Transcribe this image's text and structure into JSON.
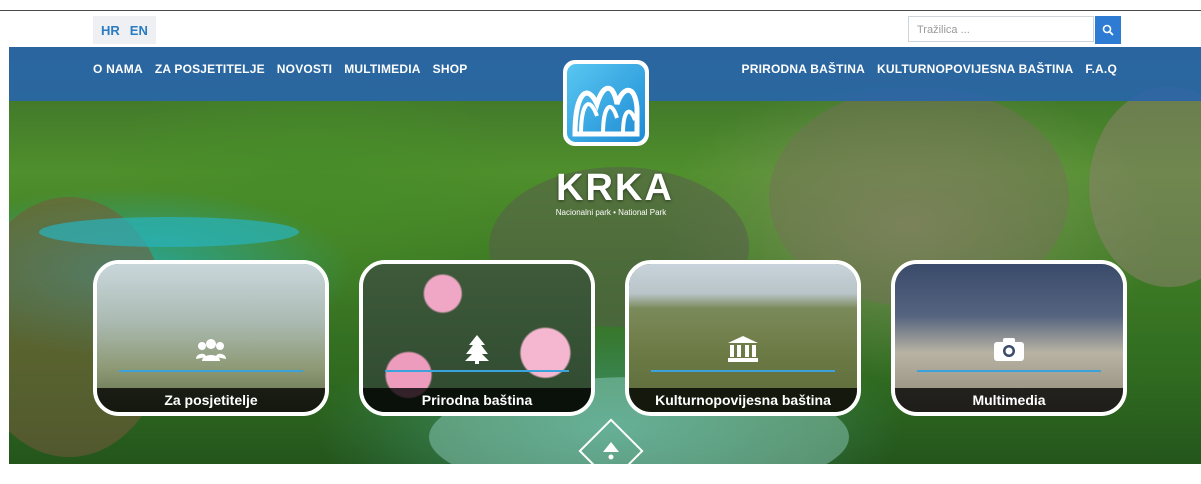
{
  "languages": [
    "HR",
    "EN"
  ],
  "search": {
    "placeholder": "Tražilica ..."
  },
  "nav": {
    "left": [
      "O NAMA",
      "ZA POSJETITELJE",
      "NOVOSTI",
      "MULTIMEDIA",
      "SHOP"
    ],
    "right": [
      "PRIRODNA BAŠTINA",
      "KULTURNOPOVIJESNA BAŠTINA",
      "F.A.Q"
    ]
  },
  "brand": {
    "name": "KRKA",
    "subtitle": "Nacionalni park • National Park"
  },
  "cards": [
    {
      "label": "Za posjetitelje",
      "icon": "users-icon"
    },
    {
      "label": "Prirodna baština",
      "icon": "tree-icon"
    },
    {
      "label": "Kulturnopovijesna baština",
      "icon": "museum-icon"
    },
    {
      "label": "Multimedia",
      "icon": "camera-icon"
    }
  ],
  "colors": {
    "nav_bg": "#2864af",
    "accent": "#2d7bd3",
    "rule": "#3aa3dc",
    "lang_text": "#2b7cc1"
  }
}
